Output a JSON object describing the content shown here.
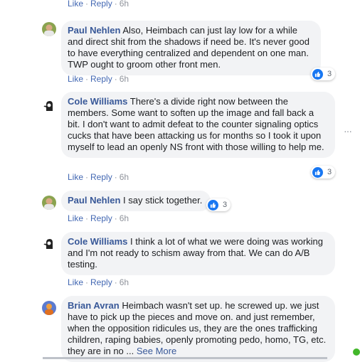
{
  "action_labels": {
    "like": "Like",
    "reply": "Reply",
    "sep": "·"
  },
  "comments": [
    {
      "author": "Paul Nehlen",
      "text": "Also, Heimbach can just lay low for a while and direct shit from the shadows if need be. It's never good to have everything centralized and dependent on one man. TWP ought to groom other front men.",
      "time": "6h",
      "likes": "3",
      "avatar": "avatar-paul"
    },
    {
      "author": "Cole Williams",
      "text": "There's a divide right now between the members. Some want to soften up the image and fall back a bit. I don't want to admit defeat to the counter signaling optics cucks that have been attacking us for months so I took it upon myself to lead an openly NS front with those willing to help me.",
      "time": "6h",
      "likes": "3",
      "avatar": "avatar-cole"
    },
    {
      "author": "Paul Nehlen",
      "text": "I say stick together.",
      "time": "6h",
      "likes": "3",
      "avatar": "avatar-paul"
    },
    {
      "author": "Cole Williams",
      "text": "I think a lot of what we were doing was working and I'm not ready to schism away from that. We can do A/B testing.",
      "time": "6h",
      "avatar": "avatar-cole"
    },
    {
      "author": "Brian Avran",
      "text": "Heimbach wasn't set up. he screwed up. we just have to pick up the pieces and move on. and just remember, when the opposition ridicules us, they are the ones trafficking children, raping babies, openly promoting pedo, homo, TG, etc. they are in no ...",
      "see_more": "See More",
      "avatar": "avatar-brian"
    }
  ],
  "top_actions": {
    "time": "6h"
  },
  "colors": {
    "link": "#4267b2",
    "name": "#385898",
    "bubble": "#f2f3f5",
    "like": "#1877f2"
  }
}
